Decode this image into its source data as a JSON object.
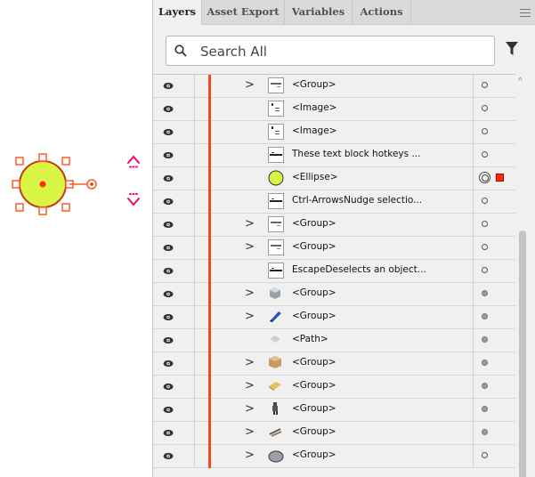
{
  "panel": {
    "tabs": [
      {
        "label": "Layers",
        "active": true
      },
      {
        "label": "Asset Export",
        "active": false
      },
      {
        "label": "Variables",
        "active": false
      },
      {
        "label": "Actions",
        "active": false
      }
    ],
    "menu_icon": "hamburger-menu-icon",
    "search": {
      "placeholder": "Search All",
      "value": ""
    },
    "filter_icon": "filter-funnel-icon"
  },
  "layers": [
    {
      "name": "<Group>",
      "expandable": true,
      "thumb": "group-thumbnail",
      "target": "hollow"
    },
    {
      "name": "<Image>",
      "expandable": false,
      "thumb": "image-thumbnail",
      "target": "hollow"
    },
    {
      "name": "<Image>",
      "expandable": false,
      "thumb": "image-thumbnail",
      "target": "hollow"
    },
    {
      "name": "These text block hotkeys ...",
      "expandable": false,
      "thumb": "text-thumbnail",
      "target": "hollow"
    },
    {
      "name": "<Ellipse>",
      "expandable": false,
      "thumb": "ellipse-thumbnail",
      "target": "selected",
      "selected": true
    },
    {
      "name": "Ctrl-ArrowsNudge selectio...",
      "expandable": false,
      "thumb": "text-thumbnail",
      "target": "hollow"
    },
    {
      "name": "<Group>",
      "expandable": true,
      "thumb": "group-thumbnail",
      "target": "hollow"
    },
    {
      "name": "<Group>",
      "expandable": true,
      "thumb": "group-thumbnail",
      "target": "hollow"
    },
    {
      "name": "EscapeDeselects an object...",
      "expandable": false,
      "thumb": "text-thumbnail",
      "target": "hollow"
    },
    {
      "name": "<Group>",
      "expandable": true,
      "thumb": "cube-thumbnail",
      "target": "filled"
    },
    {
      "name": "<Group>",
      "expandable": true,
      "thumb": "pen-thumbnail",
      "target": "filled"
    },
    {
      "name": "<Path>",
      "expandable": false,
      "thumb": "path-thumbnail",
      "target": "filled"
    },
    {
      "name": "<Group>",
      "expandable": true,
      "thumb": "box-thumbnail",
      "target": "filled"
    },
    {
      "name": "<Group>",
      "expandable": true,
      "thumb": "bread-thumbnail",
      "target": "filled"
    },
    {
      "name": "<Group>",
      "expandable": true,
      "thumb": "figure-thumbnail",
      "target": "filled"
    },
    {
      "name": "<Group>",
      "expandable": true,
      "thumb": "sticks-thumbnail",
      "target": "filled"
    },
    {
      "name": "<Group>",
      "expandable": true,
      "thumb": "disc-thumbnail",
      "target": "hollow"
    }
  ],
  "colors": {
    "layer_color": "#f04a1c",
    "ellipse_fill": "#d7f542",
    "selection": "#ff2a00",
    "canvas_arrows": "#ff0066"
  }
}
